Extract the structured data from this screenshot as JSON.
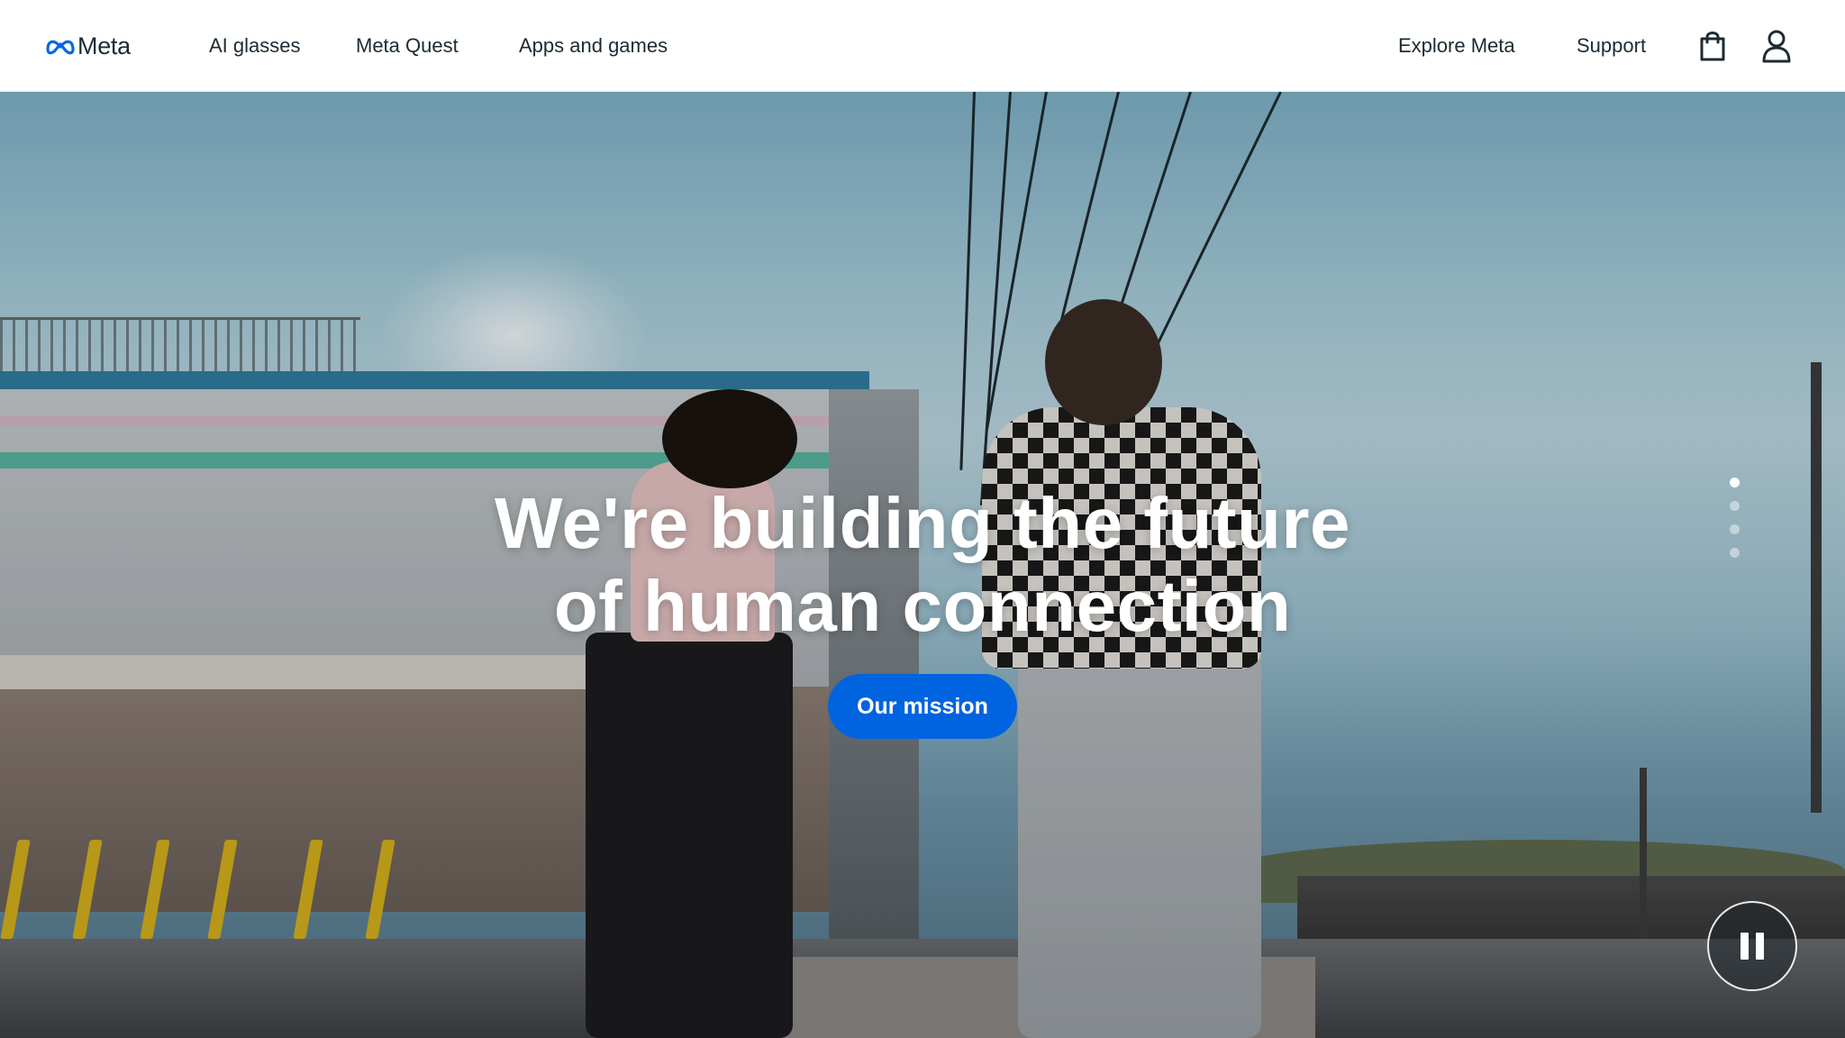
{
  "header": {
    "logo_text": "Meta",
    "nav": [
      "AI glasses",
      "Meta Quest",
      "Apps and games"
    ],
    "right_nav": [
      "Explore Meta",
      "Support"
    ],
    "icons": [
      "shopping-bag-icon",
      "user-icon"
    ]
  },
  "hero": {
    "headline_line1": "We're building the future",
    "headline_line2": "of human connection",
    "cta_label": "Our mission",
    "slides": {
      "count": 4,
      "active_index": 0
    },
    "media_control": "pause-icon"
  },
  "colors": {
    "accent": "#0064e0",
    "text": "#1c2b33",
    "background": "#ffffff"
  }
}
